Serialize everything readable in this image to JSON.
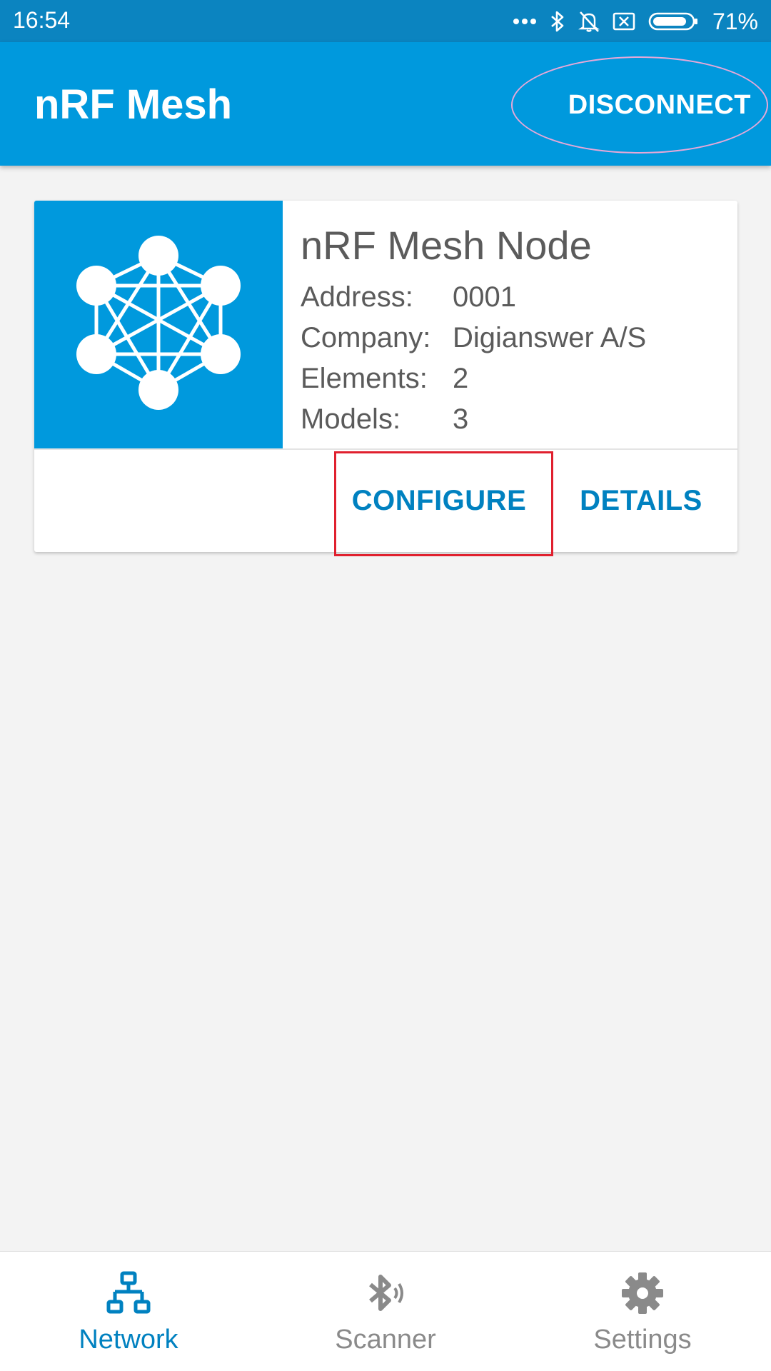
{
  "status_bar": {
    "time": "16:54",
    "battery_percent": "71%",
    "icons": [
      "more-dots-icon",
      "bluetooth-icon",
      "notifications-off-icon",
      "sim-off-icon",
      "battery-icon"
    ]
  },
  "app_bar": {
    "title": "nRF Mesh",
    "action_label": "DISCONNECT"
  },
  "node_card": {
    "image_icon": "mesh-network-icon",
    "name": "nRF Mesh Node",
    "rows": [
      {
        "key": "Address:",
        "value": "0001"
      },
      {
        "key": "Company:",
        "value": "Digianswer A/S"
      },
      {
        "key": "Elements:",
        "value": "2"
      },
      {
        "key": "Models:",
        "value": "3"
      }
    ],
    "configure_label": "CONFIGURE",
    "details_label": "DETAILS"
  },
  "bottom_nav": {
    "items": [
      {
        "label": "Network",
        "icon": "network-icon",
        "active": true
      },
      {
        "label": "Scanner",
        "icon": "bluetooth-scan-icon",
        "active": false
      },
      {
        "label": "Settings",
        "icon": "gear-icon",
        "active": false
      }
    ]
  },
  "colors": {
    "status_bar": "#0b84c0",
    "app_bar": "#0099dd",
    "accent": "#0081c0",
    "background": "#f3f3f3",
    "highlight_box": "#e0202e",
    "highlight_ring": "#e7a8d8"
  }
}
